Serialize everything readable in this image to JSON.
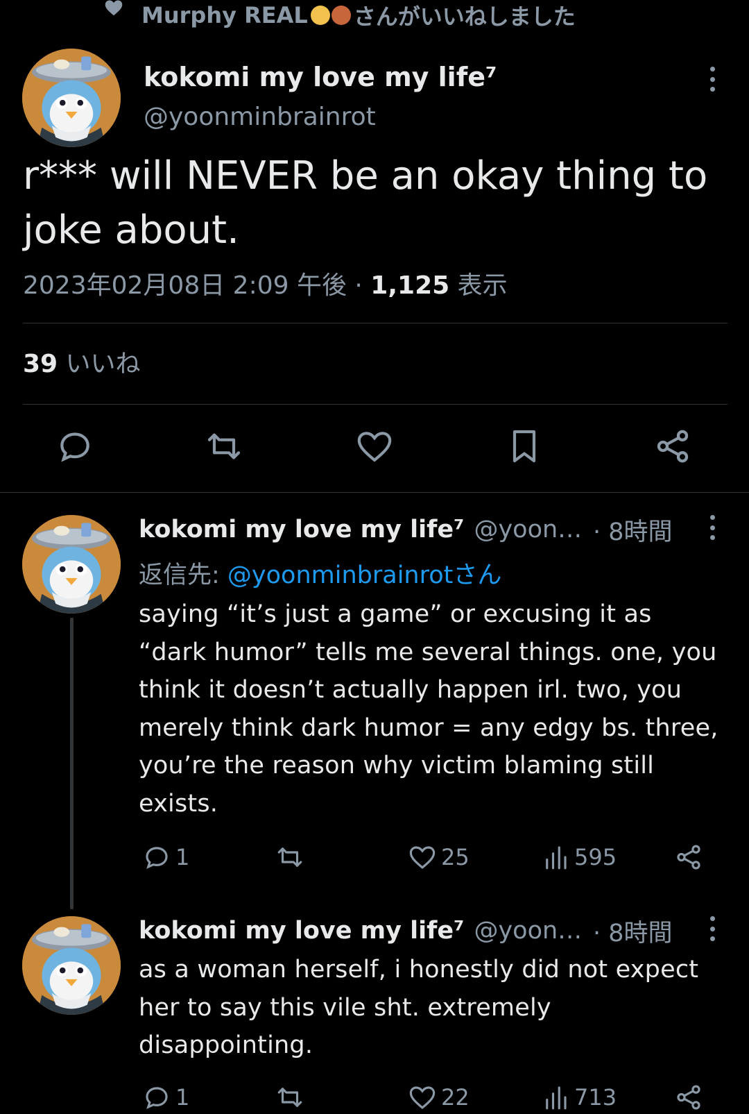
{
  "social_context": {
    "user": "Murphy REAL",
    "suffix": "さんがいいねしました"
  },
  "main_tweet": {
    "display_name": "kokomi my love my life⁷",
    "handle": "@yoonminbrainrot",
    "text": "r*** will NEVER be an okay thing to joke about.",
    "timestamp": "2023年02月08日 2:09 午後 · ",
    "views_count": "1,125",
    "views_label": " 表示",
    "likes_count": "39",
    "likes_label": " いいね"
  },
  "replies": [
    {
      "display_name": "kokomi my love my life⁷",
      "handle": "@yoon…",
      "time": "· 8時間",
      "reply_to_prefix": "返信先: ",
      "reply_to_mention": "@yoonminbrainrotさん",
      "text": "saying “it’s just a game” or excusing it as “dark humor” tells me several things. one, you think it doesn’t actually happen irl. two, you merely think dark humor = any edgy bs. three, you’re the reason why victim blaming still exists.",
      "reply_count": "1",
      "retweet_count": "",
      "like_count": "25",
      "view_count": "595"
    },
    {
      "display_name": "kokomi my love my life⁷",
      "handle": "@yoon…",
      "time": "· 8時間",
      "text": "as a woman herself, i honestly did not expect her to say this vile sht. extremely disappointing.",
      "reply_count": "1",
      "retweet_count": "",
      "like_count": "22",
      "view_count": "713"
    }
  ],
  "icons": {
    "social_context": "heart-icon",
    "more": "more-vertical-icon",
    "reply": "reply-icon",
    "retweet": "retweet-icon",
    "like": "heart-outline-icon",
    "bookmark": "bookmark-icon",
    "share": "share-icon",
    "views": "views-chart-icon"
  },
  "colors": {
    "background": "#000000",
    "text": "#e7e9ea",
    "secondary": "#8b98a5",
    "accent": "#1d9bf0",
    "divider": "#2f3336"
  }
}
